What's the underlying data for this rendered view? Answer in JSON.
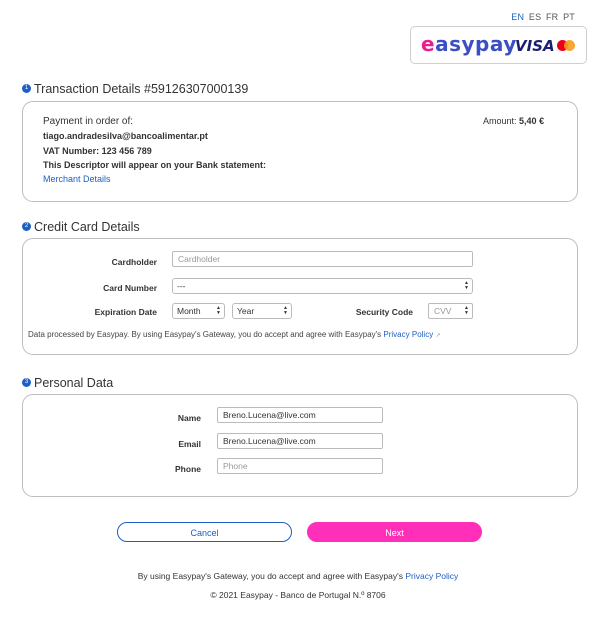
{
  "languages": [
    "EN",
    "ES",
    "FR",
    "PT"
  ],
  "brand": {
    "easypay_prefix": "e",
    "easypay_rest": "asypay",
    "visa": "VISA",
    "mastercard_icon": "mastercard-logo-icon"
  },
  "transaction": {
    "step": "1",
    "title": "Transaction Details #59126307000139",
    "payment_in_order_of": "Payment in order of:",
    "email": "tiago.andradesilva@bancoalimentar.pt",
    "vat": "VAT Number: 123 456 789",
    "descriptor": "This Descriptor will appear on your Bank statement:",
    "merchant_details": "Merchant Details",
    "amount_label": "Amount:",
    "amount_value": "5,40 €"
  },
  "credit_card": {
    "step": "2",
    "title": "Credit Card Details",
    "cardholder_label": "Cardholder",
    "cardholder_placeholder": "Cardholder",
    "card_number_label": "Card Number",
    "card_number_value": "---",
    "expiration_label": "Expiration Date",
    "month_value": "Month",
    "year_value": "Year",
    "security_label": "Security Code",
    "cvv_placeholder": "CVV",
    "notice": "Data processed by Easypay. By using Easypay's Gateway, you do accept and agree with Easypay's",
    "privacy_link": "Privacy Policy"
  },
  "personal": {
    "step": "3",
    "title": "Personal Data",
    "name_label": "Name",
    "name_value": "Breno.Lucena@live.com",
    "email_label": "Email",
    "email_value": "Breno.Lucena@live.com",
    "phone_label": "Phone",
    "phone_placeholder": "Phone"
  },
  "actions": {
    "cancel": "Cancel",
    "next": "Next"
  },
  "footer": {
    "notice": "By using Easypay's Gateway, you do accept and agree with Easypay's",
    "privacy_link": "Privacy Policy",
    "copyright": "© 2021 Easypay - Banco de Portugal N.º 8706"
  },
  "colors": {
    "accent": "#1f5fc4",
    "next_button": "#ff2fb9",
    "brand_blue": "#3b4ec4",
    "brand_pink": "#e91e8c"
  }
}
